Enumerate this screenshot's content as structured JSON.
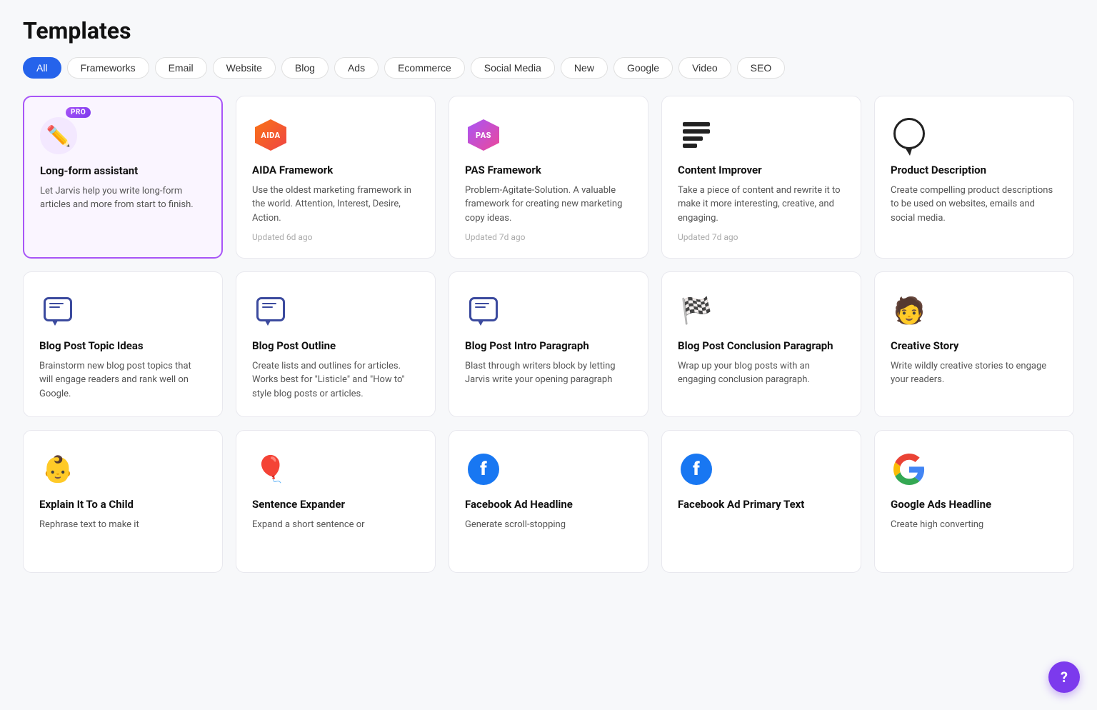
{
  "page": {
    "title": "Templates"
  },
  "filters": [
    {
      "label": "All",
      "active": true
    },
    {
      "label": "Frameworks",
      "active": false
    },
    {
      "label": "Email",
      "active": false
    },
    {
      "label": "Website",
      "active": false
    },
    {
      "label": "Blog",
      "active": false
    },
    {
      "label": "Ads",
      "active": false
    },
    {
      "label": "Ecommerce",
      "active": false
    },
    {
      "label": "Social Media",
      "active": false
    },
    {
      "label": "New",
      "active": false
    },
    {
      "label": "Google",
      "active": false
    },
    {
      "label": "Video",
      "active": false
    },
    {
      "label": "SEO",
      "active": false
    }
  ],
  "cards": [
    {
      "id": "long-form-assistant",
      "title": "Long-form assistant",
      "desc": "Let Jarvis help you write long-form articles and more from start to finish.",
      "updated": "",
      "icon": "pencil",
      "featured": true,
      "pro": true
    },
    {
      "id": "aida-framework",
      "title": "AIDA Framework",
      "desc": "Use the oldest marketing framework in the world. Attention, Interest, Desire, Action.",
      "updated": "Updated 6d ago",
      "icon": "aida",
      "featured": false,
      "pro": false
    },
    {
      "id": "pas-framework",
      "title": "PAS Framework",
      "desc": "Problem-Agitate-Solution. A valuable framework for creating new marketing copy ideas.",
      "updated": "Updated 7d ago",
      "icon": "pas",
      "featured": false,
      "pro": false
    },
    {
      "id": "content-improver",
      "title": "Content Improver",
      "desc": "Take a piece of content and rewrite it to make it more interesting, creative, and engaging.",
      "updated": "Updated 7d ago",
      "icon": "lines",
      "featured": false,
      "pro": false
    },
    {
      "id": "product-description",
      "title": "Product Description",
      "desc": "Create compelling product descriptions to be used on websites, emails and social media.",
      "updated": "",
      "icon": "speech",
      "featured": false,
      "pro": false
    },
    {
      "id": "blog-post-topic-ideas",
      "title": "Blog Post Topic Ideas",
      "desc": "Brainstorm new blog post topics that will engage readers and rank well on Google.",
      "updated": "",
      "icon": "chat-blue",
      "featured": false,
      "pro": false
    },
    {
      "id": "blog-post-outline",
      "title": "Blog Post Outline",
      "desc": "Create lists and outlines for articles. Works best for \"Listicle\" and \"How to\" style blog posts or articles.",
      "updated": "",
      "icon": "chat-blue",
      "featured": false,
      "pro": false
    },
    {
      "id": "blog-post-intro-paragraph",
      "title": "Blog Post Intro Paragraph",
      "desc": "Blast through writers block by letting Jarvis write your opening paragraph",
      "updated": "",
      "icon": "chat-blue",
      "featured": false,
      "pro": false
    },
    {
      "id": "blog-post-conclusion-paragraph",
      "title": "Blog Post Conclusion Paragraph",
      "desc": "Wrap up your blog posts with an engaging conclusion paragraph.",
      "updated": "",
      "icon": "flag",
      "featured": false,
      "pro": false
    },
    {
      "id": "creative-story",
      "title": "Creative Story",
      "desc": "Write wildly creative stories to engage your readers.",
      "updated": "",
      "icon": "person",
      "featured": false,
      "pro": false
    },
    {
      "id": "explain-to-child",
      "title": "Explain It To a Child",
      "desc": "Rephrase text to make it",
      "updated": "",
      "icon": "child",
      "featured": false,
      "pro": false
    },
    {
      "id": "sentence-expander",
      "title": "Sentence Expander",
      "desc": "Expand a short sentence or",
      "updated": "",
      "icon": "balloon",
      "featured": false,
      "pro": false
    },
    {
      "id": "facebook-ad-headline",
      "title": "Facebook Ad Headline",
      "desc": "Generate scroll-stopping",
      "updated": "",
      "icon": "facebook",
      "featured": false,
      "pro": false
    },
    {
      "id": "facebook-ad-primary-text",
      "title": "Facebook Ad Primary Text",
      "desc": "",
      "updated": "",
      "icon": "facebook",
      "featured": false,
      "pro": false
    },
    {
      "id": "google-ads-headline",
      "title": "Google Ads Headline",
      "desc": "Create high converting",
      "updated": "",
      "icon": "google",
      "featured": false,
      "pro": false
    }
  ],
  "help_button_label": "?"
}
